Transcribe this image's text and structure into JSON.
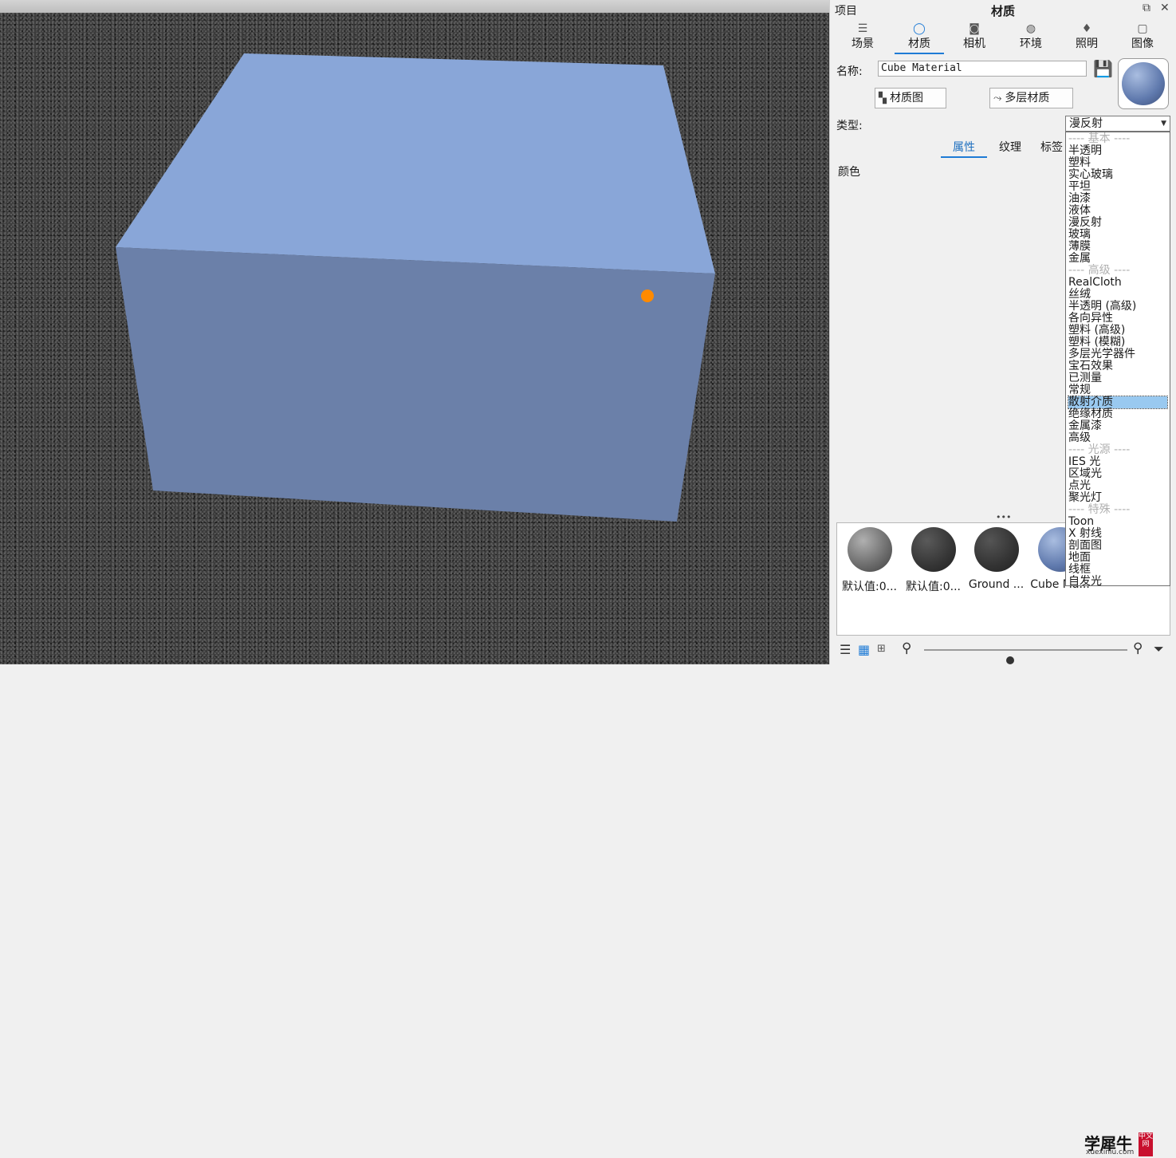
{
  "viewport": {
    "cube_top_color": "#89a6d8",
    "cube_front_color": "#6b80a9",
    "marker_color": "#ff8a00"
  },
  "panel": {
    "title_left": "项目",
    "title_center": "材质",
    "restore_icon": "restore-window-icon",
    "close_icon": "close-icon",
    "tabs": [
      {
        "label": "场景",
        "icon": "scene-icon"
      },
      {
        "label": "材质",
        "icon": "material-icon"
      },
      {
        "label": "相机",
        "icon": "camera-icon"
      },
      {
        "label": "环境",
        "icon": "environment-icon"
      },
      {
        "label": "照明",
        "icon": "lighting-icon"
      },
      {
        "label": "图像",
        "icon": "image-icon"
      }
    ],
    "active_tab": "材质",
    "name_label": "名称:",
    "name_value": "Cube Material",
    "material_graph_button": "材质图",
    "multilayer_button": "多层材质",
    "type_label": "类型:",
    "type_value": "漫反射",
    "subtabs": [
      "属性",
      "纹理",
      "标签"
    ],
    "color_label": "颜色",
    "more_dots": "•••",
    "accent_color": "#1e7bd6"
  },
  "dropdown": {
    "items": [
      {
        "text": "---- 基本 ----",
        "kind": "header"
      },
      {
        "text": "半透明"
      },
      {
        "text": "塑料"
      },
      {
        "text": "实心玻璃"
      },
      {
        "text": "平坦"
      },
      {
        "text": "油漆"
      },
      {
        "text": "液体"
      },
      {
        "text": "漫反射"
      },
      {
        "text": "玻璃"
      },
      {
        "text": "薄膜"
      },
      {
        "text": "金属"
      },
      {
        "text": "---- 高级 ----",
        "kind": "header"
      },
      {
        "text": "RealCloth"
      },
      {
        "text": "丝绒"
      },
      {
        "text": "半透明 (高级)"
      },
      {
        "text": "各向异性"
      },
      {
        "text": "塑料 (高级)"
      },
      {
        "text": "塑料 (模糊)"
      },
      {
        "text": "多层光学器件"
      },
      {
        "text": "宝石效果"
      },
      {
        "text": "已测量"
      },
      {
        "text": "常规"
      },
      {
        "text": "散射介质",
        "kind": "selected"
      },
      {
        "text": "绝缘材质"
      },
      {
        "text": "金属漆"
      },
      {
        "text": "高级"
      },
      {
        "text": "---- 光源 ----",
        "kind": "header"
      },
      {
        "text": "IES 光"
      },
      {
        "text": "区域光"
      },
      {
        "text": "点光"
      },
      {
        "text": "聚光灯"
      },
      {
        "text": "---- 特殊 ----",
        "kind": "header"
      },
      {
        "text": "Toon"
      },
      {
        "text": "X 射线"
      },
      {
        "text": "剖面图"
      },
      {
        "text": "地面"
      },
      {
        "text": "线框"
      },
      {
        "text": "自发光"
      }
    ]
  },
  "swatches": [
    {
      "label": "默认值:0...",
      "color": "#7a7a7a"
    },
    {
      "label": "默认值:0...",
      "color": "#3a3a3a"
    },
    {
      "label": "Ground ...",
      "color": "#3c3c3c"
    },
    {
      "label": "Cube Ma...",
      "color": "#6f86b6"
    }
  ],
  "watermark": {
    "text": "学犀牛",
    "badge": "中文网",
    "url": "xuexiniu.com"
  },
  "bottombar": {
    "list_view_icon": "list-view-icon",
    "grid_view_icon": "grid-view-icon",
    "tree_view_icon": "tree-view-icon",
    "zoom_out_icon": "zoom-out-icon",
    "zoom_in_icon": "zoom-in-icon",
    "filter_icon": "filter-icon",
    "zoom_level": 0.42
  }
}
